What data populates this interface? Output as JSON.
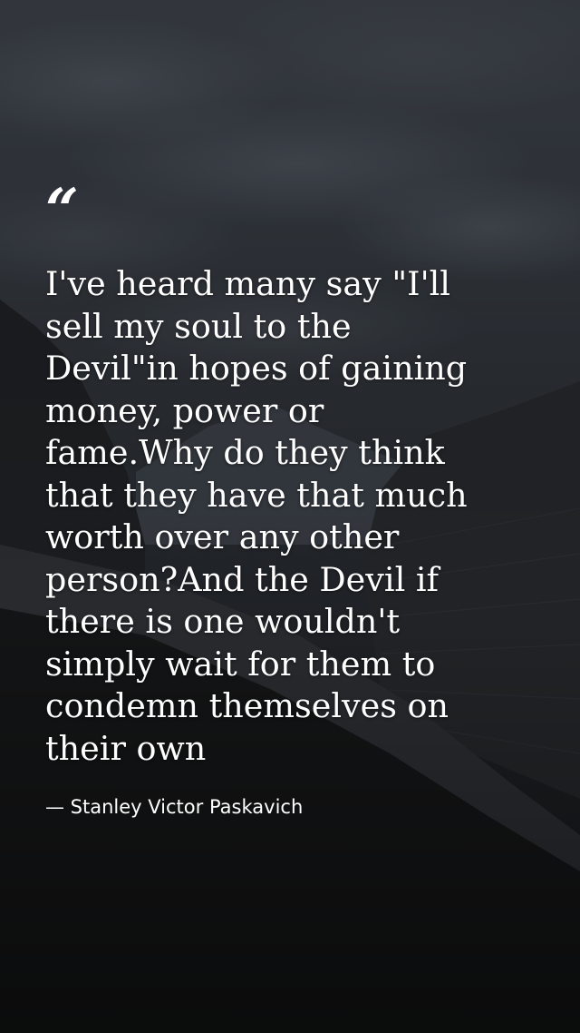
{
  "quote": {
    "mark": "“",
    "lines": [
      "I've heard many say \"I'll",
      "sell my soul to the",
      "Devil\"in hopes of gaining",
      "money, power or",
      "fame.Why do they think",
      "that they have that much",
      "worth over any other",
      "person?And the Devil if",
      "there is one wouldn't",
      "simply wait for them to",
      "condemn themselves on",
      "their own"
    ],
    "author": "— Stanley Victor Paskavich"
  },
  "background": {
    "description_icon": "mountain-landscape-photo",
    "sky_color": "#3b4047",
    "ground_color": "#121314"
  }
}
